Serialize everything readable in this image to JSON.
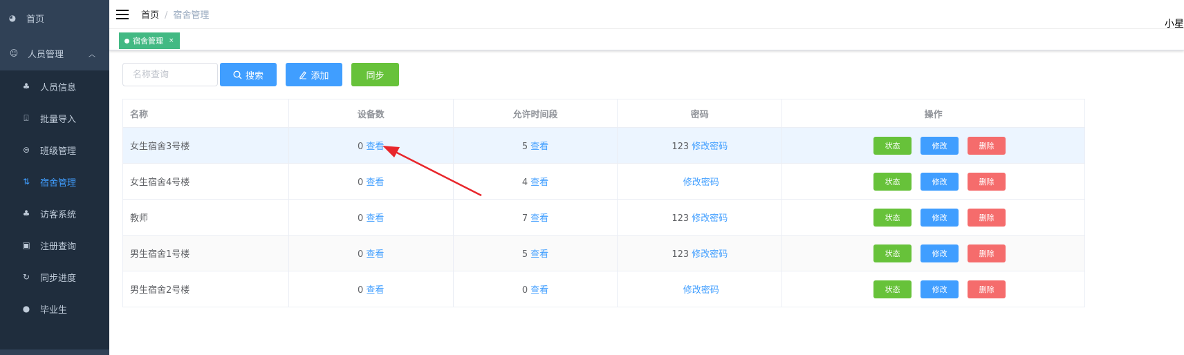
{
  "sidebar": {
    "items": [
      {
        "label": "首页",
        "icon": "dashboard-icon",
        "level": "top"
      },
      {
        "label": "人员管理",
        "icon": "robot-icon",
        "level": "group",
        "expanded": true
      },
      {
        "label": "人员信息",
        "icon": "org-tree-icon",
        "level": "sub"
      },
      {
        "label": "批量导入",
        "icon": "import-icon",
        "level": "sub"
      },
      {
        "label": "班级管理",
        "icon": "list-circle-icon",
        "level": "sub"
      },
      {
        "label": "宿舍管理",
        "icon": "sort-arrows-icon",
        "level": "sub",
        "active": true
      },
      {
        "label": "访客系统",
        "icon": "org-tree-icon",
        "level": "sub"
      },
      {
        "label": "注册查询",
        "icon": "monitor-card-icon",
        "level": "sub"
      },
      {
        "label": "同步进度",
        "icon": "refresh-icon",
        "level": "sub"
      },
      {
        "label": "毕业生",
        "icon": "user-icon",
        "level": "sub"
      }
    ]
  },
  "navbar": {
    "breadcrumb": [
      "首页",
      "宿舍管理"
    ],
    "separator": "/",
    "user": "小星"
  },
  "tags": [
    {
      "label": "宿舍管理",
      "close": "×",
      "active": true
    }
  ],
  "toolbar": {
    "search_placeholder": "名称查询",
    "search_value": "",
    "search_label": "搜索",
    "add_label": "添加",
    "sync_label": "同步"
  },
  "table": {
    "columns": [
      "名称",
      "设备数",
      "允许时间段",
      "密码",
      "操作"
    ],
    "rows": [
      {
        "name": "女生宿舍3号楼",
        "devices": "0",
        "times": "5",
        "password": "123"
      },
      {
        "name": "女生宿舍4号楼",
        "devices": "0",
        "times": "4",
        "password": ""
      },
      {
        "name": "教师",
        "devices": "0",
        "times": "7",
        "password": "123"
      },
      {
        "name": "男生宿舍1号楼",
        "devices": "0",
        "times": "5",
        "password": "123"
      },
      {
        "name": "男生宿舍2号楼",
        "devices": "0",
        "times": "0",
        "password": ""
      }
    ],
    "view_label": "查看",
    "change_pwd_label": "修改密码",
    "actions": {
      "status": "状态",
      "edit": "修改",
      "delete": "删除"
    }
  },
  "colors": {
    "sidebar_bg": "#1f2d3d",
    "sidebar_top": "#304156",
    "active": "#409eff",
    "primary": "#409eff",
    "success": "#67c23a",
    "danger": "#f56c6c",
    "tag": "#42b983",
    "annotation_arrow": "#e8262b"
  }
}
